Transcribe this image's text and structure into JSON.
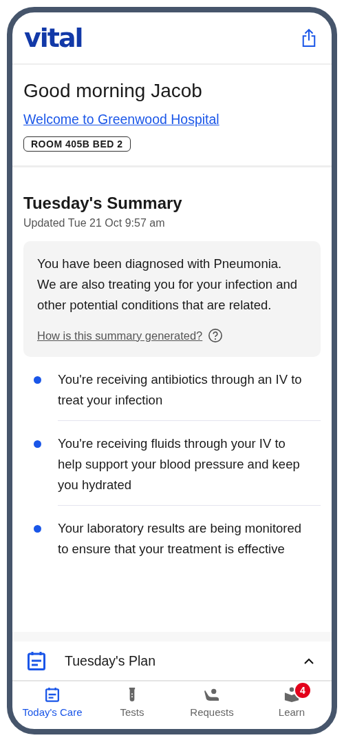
{
  "header": {
    "logo": "vital"
  },
  "greeting": {
    "title": "Good morning Jacob",
    "link": "Welcome to Greenwood Hospital",
    "room_badge": "ROOM 405B BED 2"
  },
  "summary": {
    "title": "Tuesday's Summary",
    "updated": "Updated Tue 21 Oct 9:57 am",
    "diagnosis": "You have been diagnosed with Pneumonia. We are also treating you for your infection and other potential conditions that are related.",
    "help_link": "How is this summary generated?",
    "points": [
      "You're receiving antibiotics through an IV to treat your infection",
      "You're receiving fluids through your IV to help support your blood pressure and keep you hydrated",
      "Your laboratory results are being monitored to ensure that your treatment is effective"
    ]
  },
  "plan": {
    "title": "Tuesday's Plan",
    "expanded": true
  },
  "tabs": [
    {
      "label": "Today's Care",
      "kind": "care",
      "selected": true
    },
    {
      "label": "Tests",
      "kind": "tests",
      "selected": false
    },
    {
      "label": "Requests",
      "kind": "requests",
      "selected": false
    },
    {
      "label": "Learn",
      "kind": "learn",
      "selected": false,
      "badge": "4"
    }
  ]
}
